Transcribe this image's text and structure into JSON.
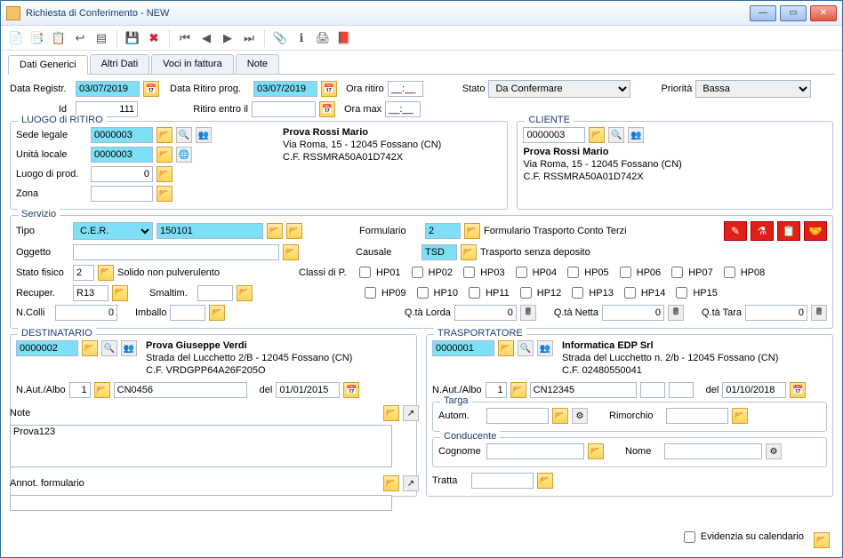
{
  "window": {
    "title": "Richiesta di Conferimento - NEW"
  },
  "tabs": [
    "Dati Generici",
    "Altri Dati",
    "Voci in fattura",
    "Note"
  ],
  "top": {
    "data_registr_lbl": "Data Registr.",
    "data_registr": "03/07/2019",
    "data_ritiro_lbl": "Data Ritiro prog.",
    "data_ritiro": "03/07/2019",
    "ora_ritiro_lbl": "Ora ritiro",
    "ora_ritiro": "__:__",
    "stato_lbl": "Stato",
    "stato": "Da Confermare",
    "priorita_lbl": "Priorità",
    "priorita": "Bassa",
    "id_lbl": "Id",
    "id": "111",
    "ritiro_entro_lbl": "Ritiro entro il",
    "ritiro_entro": "",
    "ora_max_lbl": "Ora max",
    "ora_max": "__:__"
  },
  "luogo": {
    "legend": "LUOGO di RITIRO",
    "sede_lbl": "Sede legale",
    "sede": "0000003",
    "unita_lbl": "Unità locale",
    "unita": "0000003",
    "luogo_prod_lbl": "Luogo di prod.",
    "luogo_prod": "0",
    "zona_lbl": "Zona",
    "zona": "",
    "name": "Prova Rossi Mario",
    "addr": "Via Roma, 15 - 12045 Fossano (CN)",
    "cf": "C.F. RSSMRA50A01D742X"
  },
  "cliente": {
    "legend": "CLIENTE",
    "code": "0000003",
    "name": "Prova Rossi Mario",
    "addr": "Via Roma, 15 - 12045 Fossano (CN)",
    "cf": "C.F. RSSMRA50A01D742X"
  },
  "servizio": {
    "legend": "Servizio",
    "tipo_lbl": "Tipo",
    "tipo": "C.E.R.",
    "cer": "150101",
    "formulario_lbl": "Formulario",
    "formulario": "2",
    "formulario_desc": "Formulario Trasporto Conto Terzi",
    "oggetto_lbl": "Oggetto",
    "oggetto": "",
    "causale_lbl": "Causale",
    "causale": "TSD",
    "causale_desc": "Trasporto senza deposito",
    "stato_fisico_lbl": "Stato fisico",
    "stato_fisico": "2",
    "stato_fisico_desc": "Solido non pulverulento",
    "classi_lbl": "Classi di P.",
    "hp_row1": [
      "HP01",
      "HP02",
      "HP03",
      "HP04",
      "HP05",
      "HP06",
      "HP07",
      "HP08"
    ],
    "hp_row2": [
      "HP09",
      "HP10",
      "HP11",
      "HP12",
      "HP13",
      "HP14",
      "HP15"
    ],
    "recuper_lbl": "Recuper.",
    "recuper": "R13",
    "smaltim_lbl": "Smaltim.",
    "smaltim": "",
    "ncolli_lbl": "N.Colli",
    "ncolli": "0",
    "imballo_lbl": "Imballo",
    "imballo": "",
    "qlorda_lbl": "Q.tà Lorda",
    "qlorda": "0",
    "qnetta_lbl": "Q.tà Netta",
    "qnetta": "0",
    "qtara_lbl": "Q.tà Tara",
    "qtara": "0"
  },
  "dest": {
    "legend": "DESTINATARIO",
    "code": "0000002",
    "name": "Prova Giuseppe Verdi",
    "addr": "Strada del Lucchetto 2/B - 12045 Fossano (CN)",
    "cf": "C.F. VRDGPP64A26F205O",
    "naut_lbl": "N.Aut./Albo",
    "naut_n": "1",
    "naut_code": "CN0456",
    "del_lbl": "del",
    "del": "01/01/2015"
  },
  "trasp": {
    "legend": "TRASPORTATORE",
    "code": "0000001",
    "name": "Informatica EDP Srl",
    "addr": "Strada del Lucchetto n. 2/b - 12045 Fossano (CN)",
    "cf": "C.F. 02480550041",
    "naut_lbl": "N.Aut./Albo",
    "naut_n": "1",
    "naut_code": "CN12345",
    "del_lbl": "del",
    "del": "01/10/2018",
    "targa_legend": "Targa",
    "autom_lbl": "Autom.",
    "autom": "",
    "rimorchio_lbl": "Rimorchio",
    "rimorchio": "",
    "cond_legend": "Conducente",
    "cognome_lbl": "Cognome",
    "cognome": "",
    "nome_lbl": "Nome",
    "nome": "",
    "tratta_lbl": "Tratta",
    "tratta": ""
  },
  "note": {
    "lbl": "Note",
    "text": "Prova123",
    "annot_lbl": "Annot. formulario",
    "annot": ""
  },
  "footer": {
    "evidenzia": "Evidenzia su calendario"
  }
}
